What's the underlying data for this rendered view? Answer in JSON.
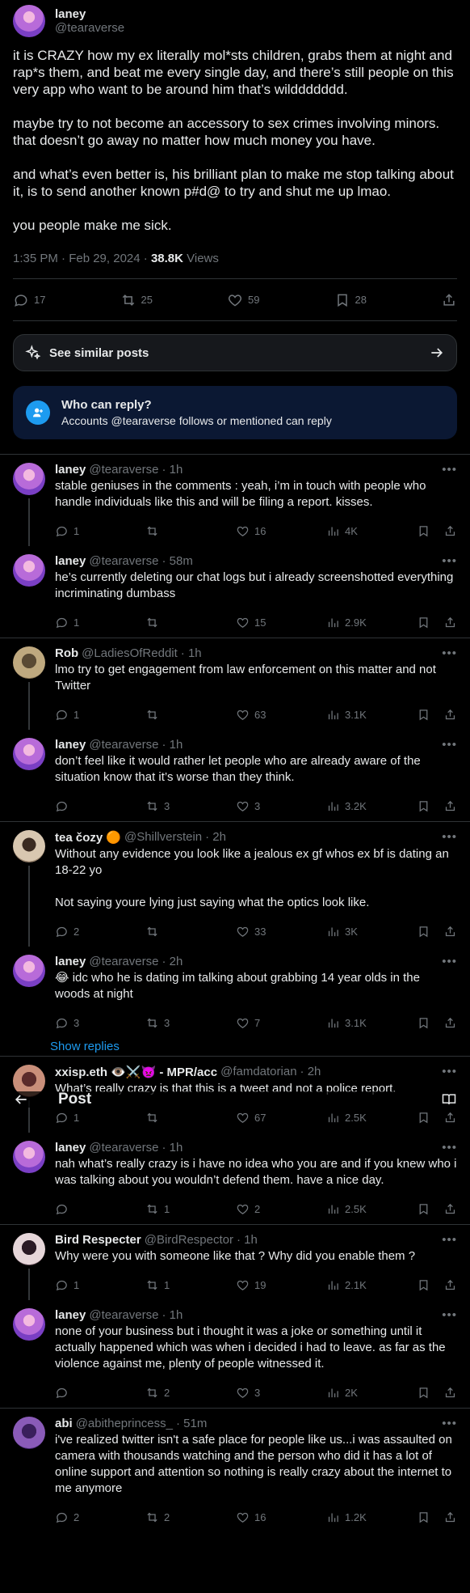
{
  "main_post": {
    "name": "laney",
    "handle": "@tearaverse",
    "text": "it is CRAZY how my ex literally mol*sts children, grabs them at night and rap*s them, and beat me every single day, and there’s still people on this very app who want to be around him that’s wilddddddd.\n\nmaybe try to not become an accessory to sex crimes involving minors. that doesn’t go away no matter how much money you have.\n\nand what’s even better is, his brilliant plan to make me stop talking about it, is to send another known p#d@ to try and shut me up lmao.\n\nyou people make me sick.",
    "timestamp": "1:35 PM · Feb 29, 2024 · ",
    "views_count": "38.8K",
    "views_label": " Views",
    "replies": "17",
    "reposts": "25",
    "likes": "59",
    "bookmarks": "28"
  },
  "similar_posts": {
    "label": "See similar posts"
  },
  "who_can_reply": {
    "title": "Who can reply?",
    "text": "Accounts @tearaverse follows or mentioned can reply"
  },
  "post_header": {
    "title": "Post"
  },
  "show_replies": "Show replies",
  "replies": [
    {
      "name": "laney",
      "handle": "@tearaverse",
      "time": "· 1h",
      "text": "stable geniuses in the comments : yeah, i’m in touch with people who handle individuals like this and will be filing a report. kisses.",
      "replies": "1",
      "reposts": "",
      "likes": "16",
      "views": "4K"
    },
    {
      "name": "laney",
      "handle": "@tearaverse",
      "time": "· 58m",
      "text": "he’s currently deleting our chat logs but i already screenshotted everything incriminating dumbass",
      "replies": "1",
      "reposts": "",
      "likes": "15",
      "views": "2.9K"
    },
    {
      "name": "Rob",
      "handle": "@LadiesOfReddit",
      "time": "· 1h",
      "text": "lmo try to get engagement from law enforcement on this matter and not Twitter",
      "replies": "1",
      "reposts": "",
      "likes": "63",
      "views": "3.1K"
    },
    {
      "name": "laney",
      "handle": "@tearaverse",
      "time": "· 1h",
      "text": "don’t feel like it would rather let people who are already aware of the situation know that it’s worse than they think.",
      "replies": "",
      "reposts": "3",
      "likes": "3",
      "views": "3.2K"
    },
    {
      "name": "tea čozy 🟠",
      "handle": "@Shillverstein",
      "time": "· 2h",
      "text": "Without any evidence you look like a jealous ex gf whos ex bf is dating an 18-22 yo\n\nNot saying youre lying just saying what the optics look like.",
      "replies": "2",
      "reposts": "",
      "likes": "33",
      "views": "3K"
    },
    {
      "name": "laney",
      "handle": "@tearaverse",
      "time": "· 2h",
      "text": "😂 idc who he is dating im talking about grabbing 14 year olds in the woods at night",
      "replies": "3",
      "reposts": "3",
      "likes": "7",
      "views": "3.1K"
    },
    {
      "name": "xxisp.eth 👁️⚔️👿 - MPR/acc",
      "handle": "@famdatorian",
      "time": "· 2h",
      "text": "What’s really crazy is that this is a tweet and not a police report.",
      "replies": "1",
      "reposts": "",
      "likes": "67",
      "views": "2.5K"
    },
    {
      "name": "laney",
      "handle": "@tearaverse",
      "time": "· 1h",
      "text": "nah what’s really crazy is i have no idea who you are and if you knew who i was talking about you wouldn’t defend them. have a nice day.",
      "replies": "",
      "reposts": "1",
      "likes": "2",
      "views": "2.5K"
    },
    {
      "name": "Bird Respecter",
      "handle": "@BirdRespector",
      "time": "· 1h",
      "text": "Why were you with someone like that ? Why did you enable them ?",
      "replies": "1",
      "reposts": "1",
      "likes": "19",
      "views": "2.1K"
    },
    {
      "name": "laney",
      "handle": "@tearaverse",
      "time": "· 1h",
      "text": "none of your business but i thought it was a joke or something until it actually happened which was when i decided i had to leave. as far as the violence against me, plenty of people witnessed it.",
      "replies": "",
      "reposts": "2",
      "likes": "3",
      "views": "2K"
    },
    {
      "name": "abi",
      "handle": "@abitheprincess_",
      "time": "· 51m",
      "text": "i've realized twitter isn't a safe place for people like us...i was assaulted on camera with thousands watching and the person who did it has a lot of online support and attention so nothing is really crazy about the internet to me anymore",
      "replies": "2",
      "reposts": "2",
      "likes": "16",
      "views": "1.2K"
    }
  ],
  "icons": {
    "reply": "reply-icon",
    "repost": "repost-icon",
    "like": "heart-icon",
    "views": "views-icon",
    "bookmark": "bookmark-icon",
    "share": "share-icon",
    "sparkle": "sparkle-icon",
    "arrow_right": "arrow-right-icon",
    "back": "back-arrow-icon",
    "reader": "reader-icon",
    "person": "person-icon"
  },
  "colors": {
    "accent": "#1d9bf0",
    "text": "#e7e9ea",
    "muted": "#71767b",
    "border": "#2f3336",
    "background": "#000000"
  }
}
